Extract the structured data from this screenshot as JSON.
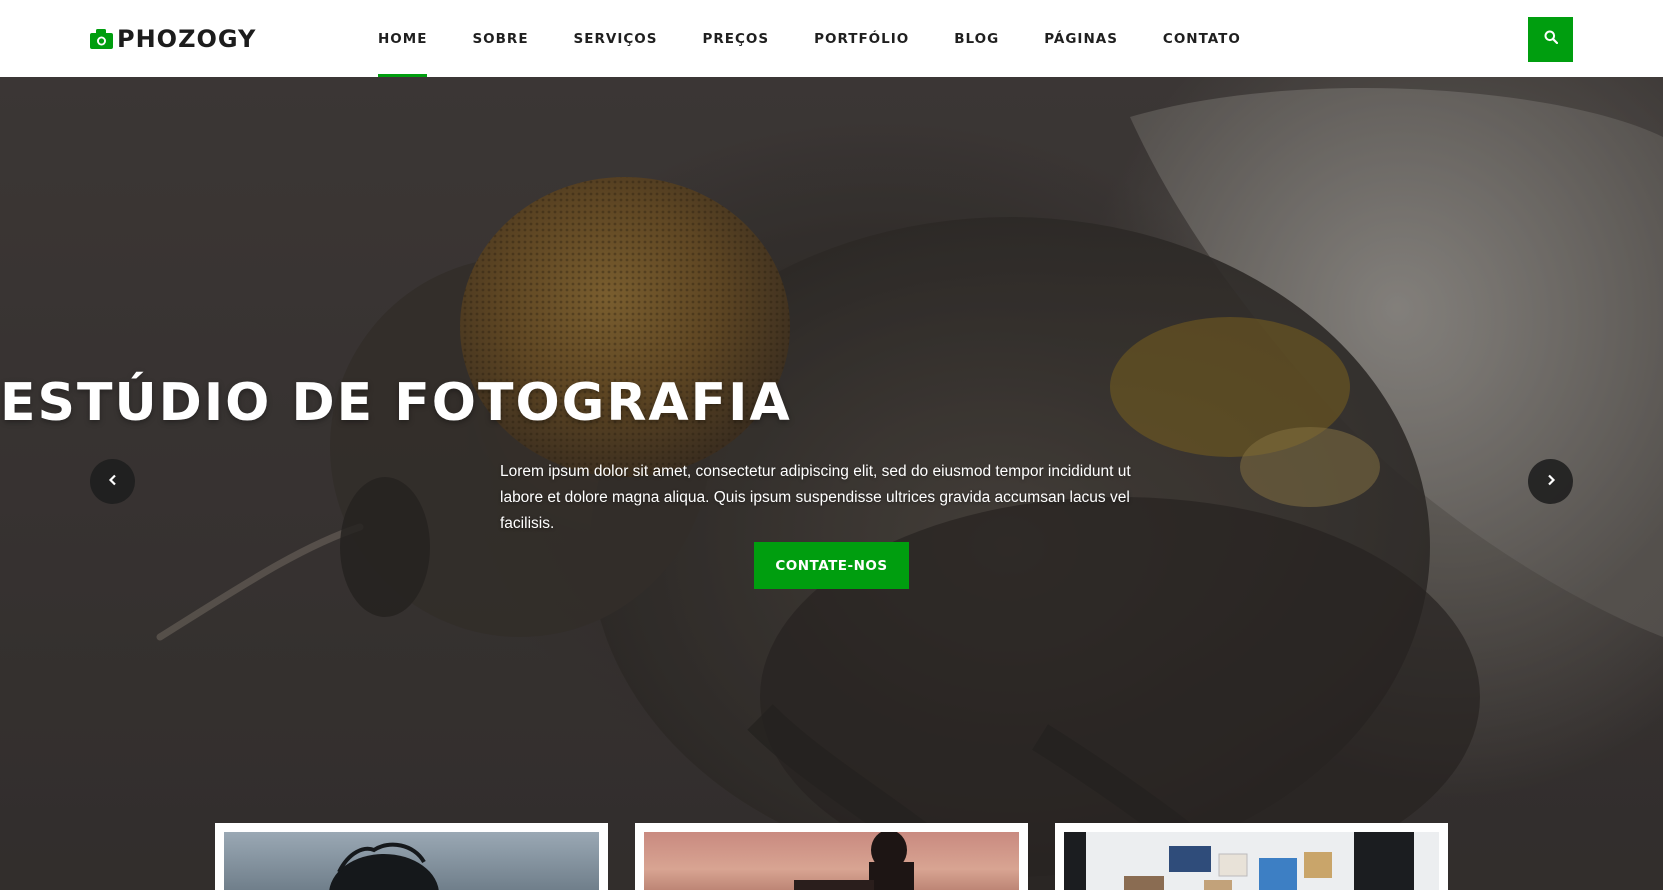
{
  "brand": {
    "name": "PHOZOGY",
    "logo_icon": "camera-icon",
    "accent_color": "#009e0f"
  },
  "nav": {
    "items": [
      {
        "label": "HOME",
        "active": true
      },
      {
        "label": "SOBRE",
        "active": false
      },
      {
        "label": "SERVIÇOS",
        "active": false
      },
      {
        "label": "PREÇOS",
        "active": false
      },
      {
        "label": "PORTFÓLIO",
        "active": false
      },
      {
        "label": "BLOG",
        "active": false
      },
      {
        "label": "PÁGINAS",
        "active": false
      },
      {
        "label": "CONTATO",
        "active": false
      }
    ],
    "search_icon": "search-icon"
  },
  "hero": {
    "title": "ESTÚDIO DE FOTOGRAFIA",
    "text": "Lorem ipsum dolor sit amet, consectetur adipiscing elit, sed do eiusmod tempor incididunt ut labore et dolore magna aliqua. Quis ipsum suspendisse ultrices gravida accumsan lacus vel facilisis.",
    "cta_label": "CONTATE-NOS",
    "prev_icon": "chevron-left-icon",
    "next_icon": "chevron-right-icon"
  },
  "cards": [
    {
      "image": "silhouette-photo"
    },
    {
      "image": "sunset-photographer-photo"
    },
    {
      "image": "gallery-wall-photo"
    }
  ]
}
